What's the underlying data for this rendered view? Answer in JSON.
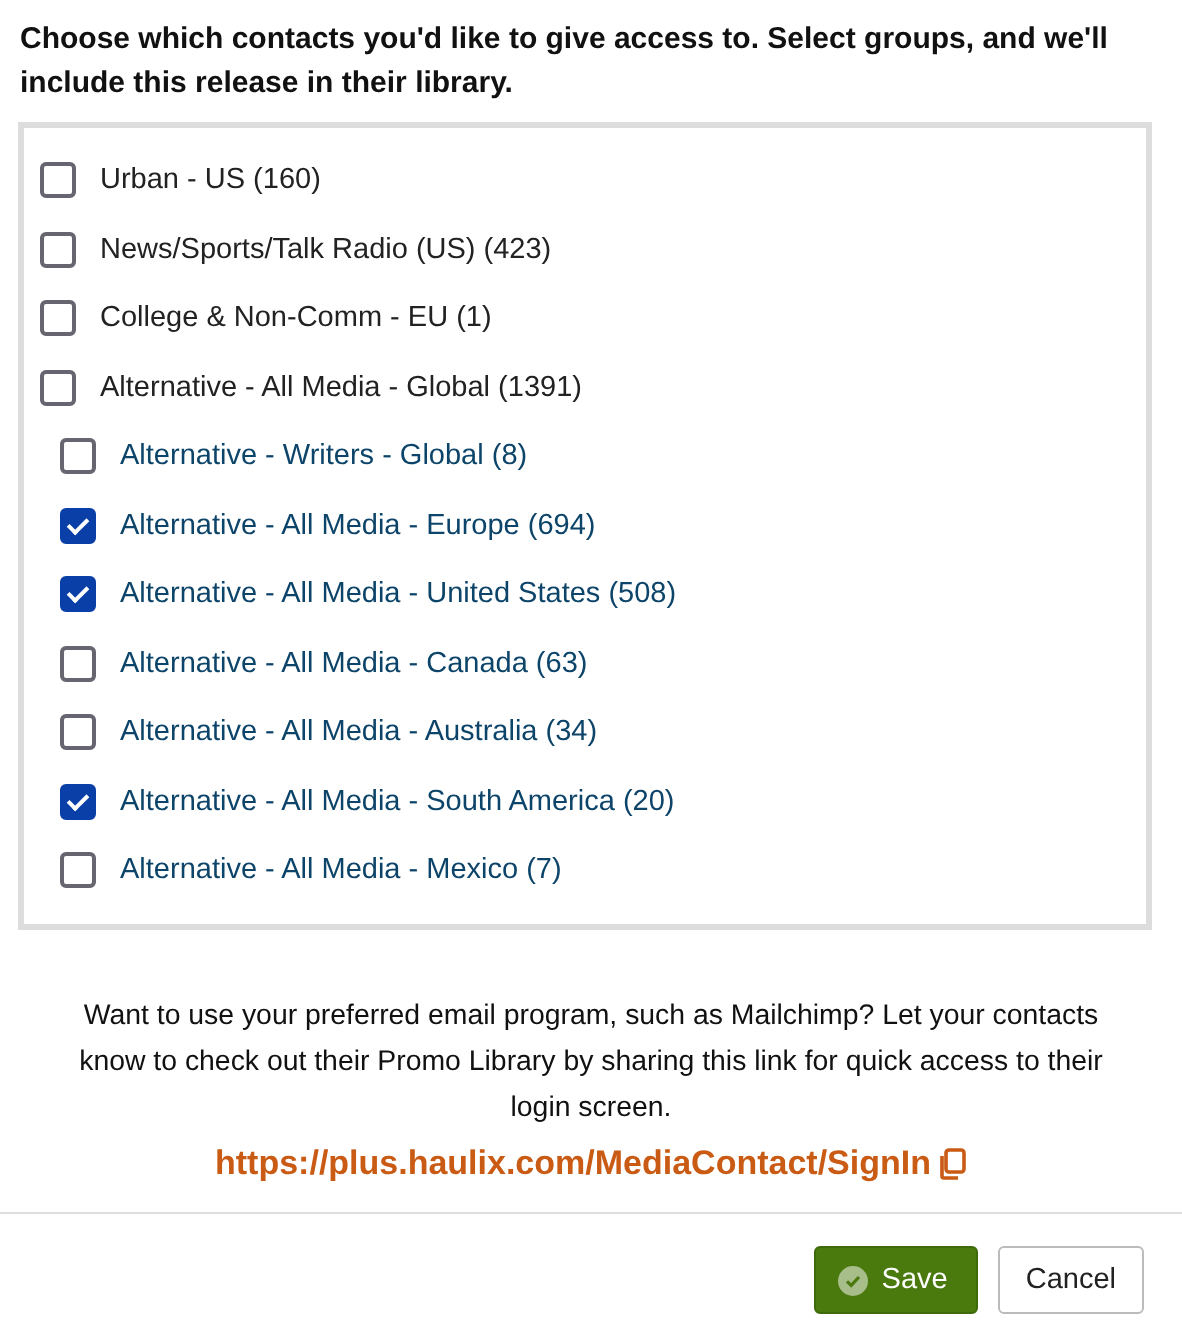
{
  "heading": "Choose which contacts you'd like to give access to. Select groups, and we'll include this release in their library.",
  "groups": [
    {
      "label": "Urban - US (160)",
      "checked": false
    },
    {
      "label": "News/Sports/Talk Radio (US) (423)",
      "checked": false
    },
    {
      "label": "College & Non-Comm - EU (1)",
      "checked": false
    },
    {
      "label": "Alternative - All Media - Global (1391)",
      "checked": false,
      "children": [
        {
          "label": "Alternative - Writers - Global (8)",
          "checked": false
        },
        {
          "label": "Alternative - All Media - Europe (694)",
          "checked": true
        },
        {
          "label": "Alternative - All Media - United States (508)",
          "checked": true
        },
        {
          "label": "Alternative - All Media - Canada (63)",
          "checked": false
        },
        {
          "label": "Alternative - All Media - Australia (34)",
          "checked": false
        },
        {
          "label": "Alternative - All Media - South America (20)",
          "checked": true
        },
        {
          "label": "Alternative - All Media - Mexico (7)",
          "checked": false
        }
      ]
    }
  ],
  "info": "Want to use your preferred email program, such as Mailchimp? Let your contacts know to check out their Promo Library by sharing this link for quick access to their login screen.",
  "link": "https://plus.haulix.com/MediaContact/SignIn",
  "buttons": [
    {
      "label": "Save",
      "kind": "primary"
    },
    {
      "label": "Cancel",
      "kind": "secondary"
    }
  ]
}
